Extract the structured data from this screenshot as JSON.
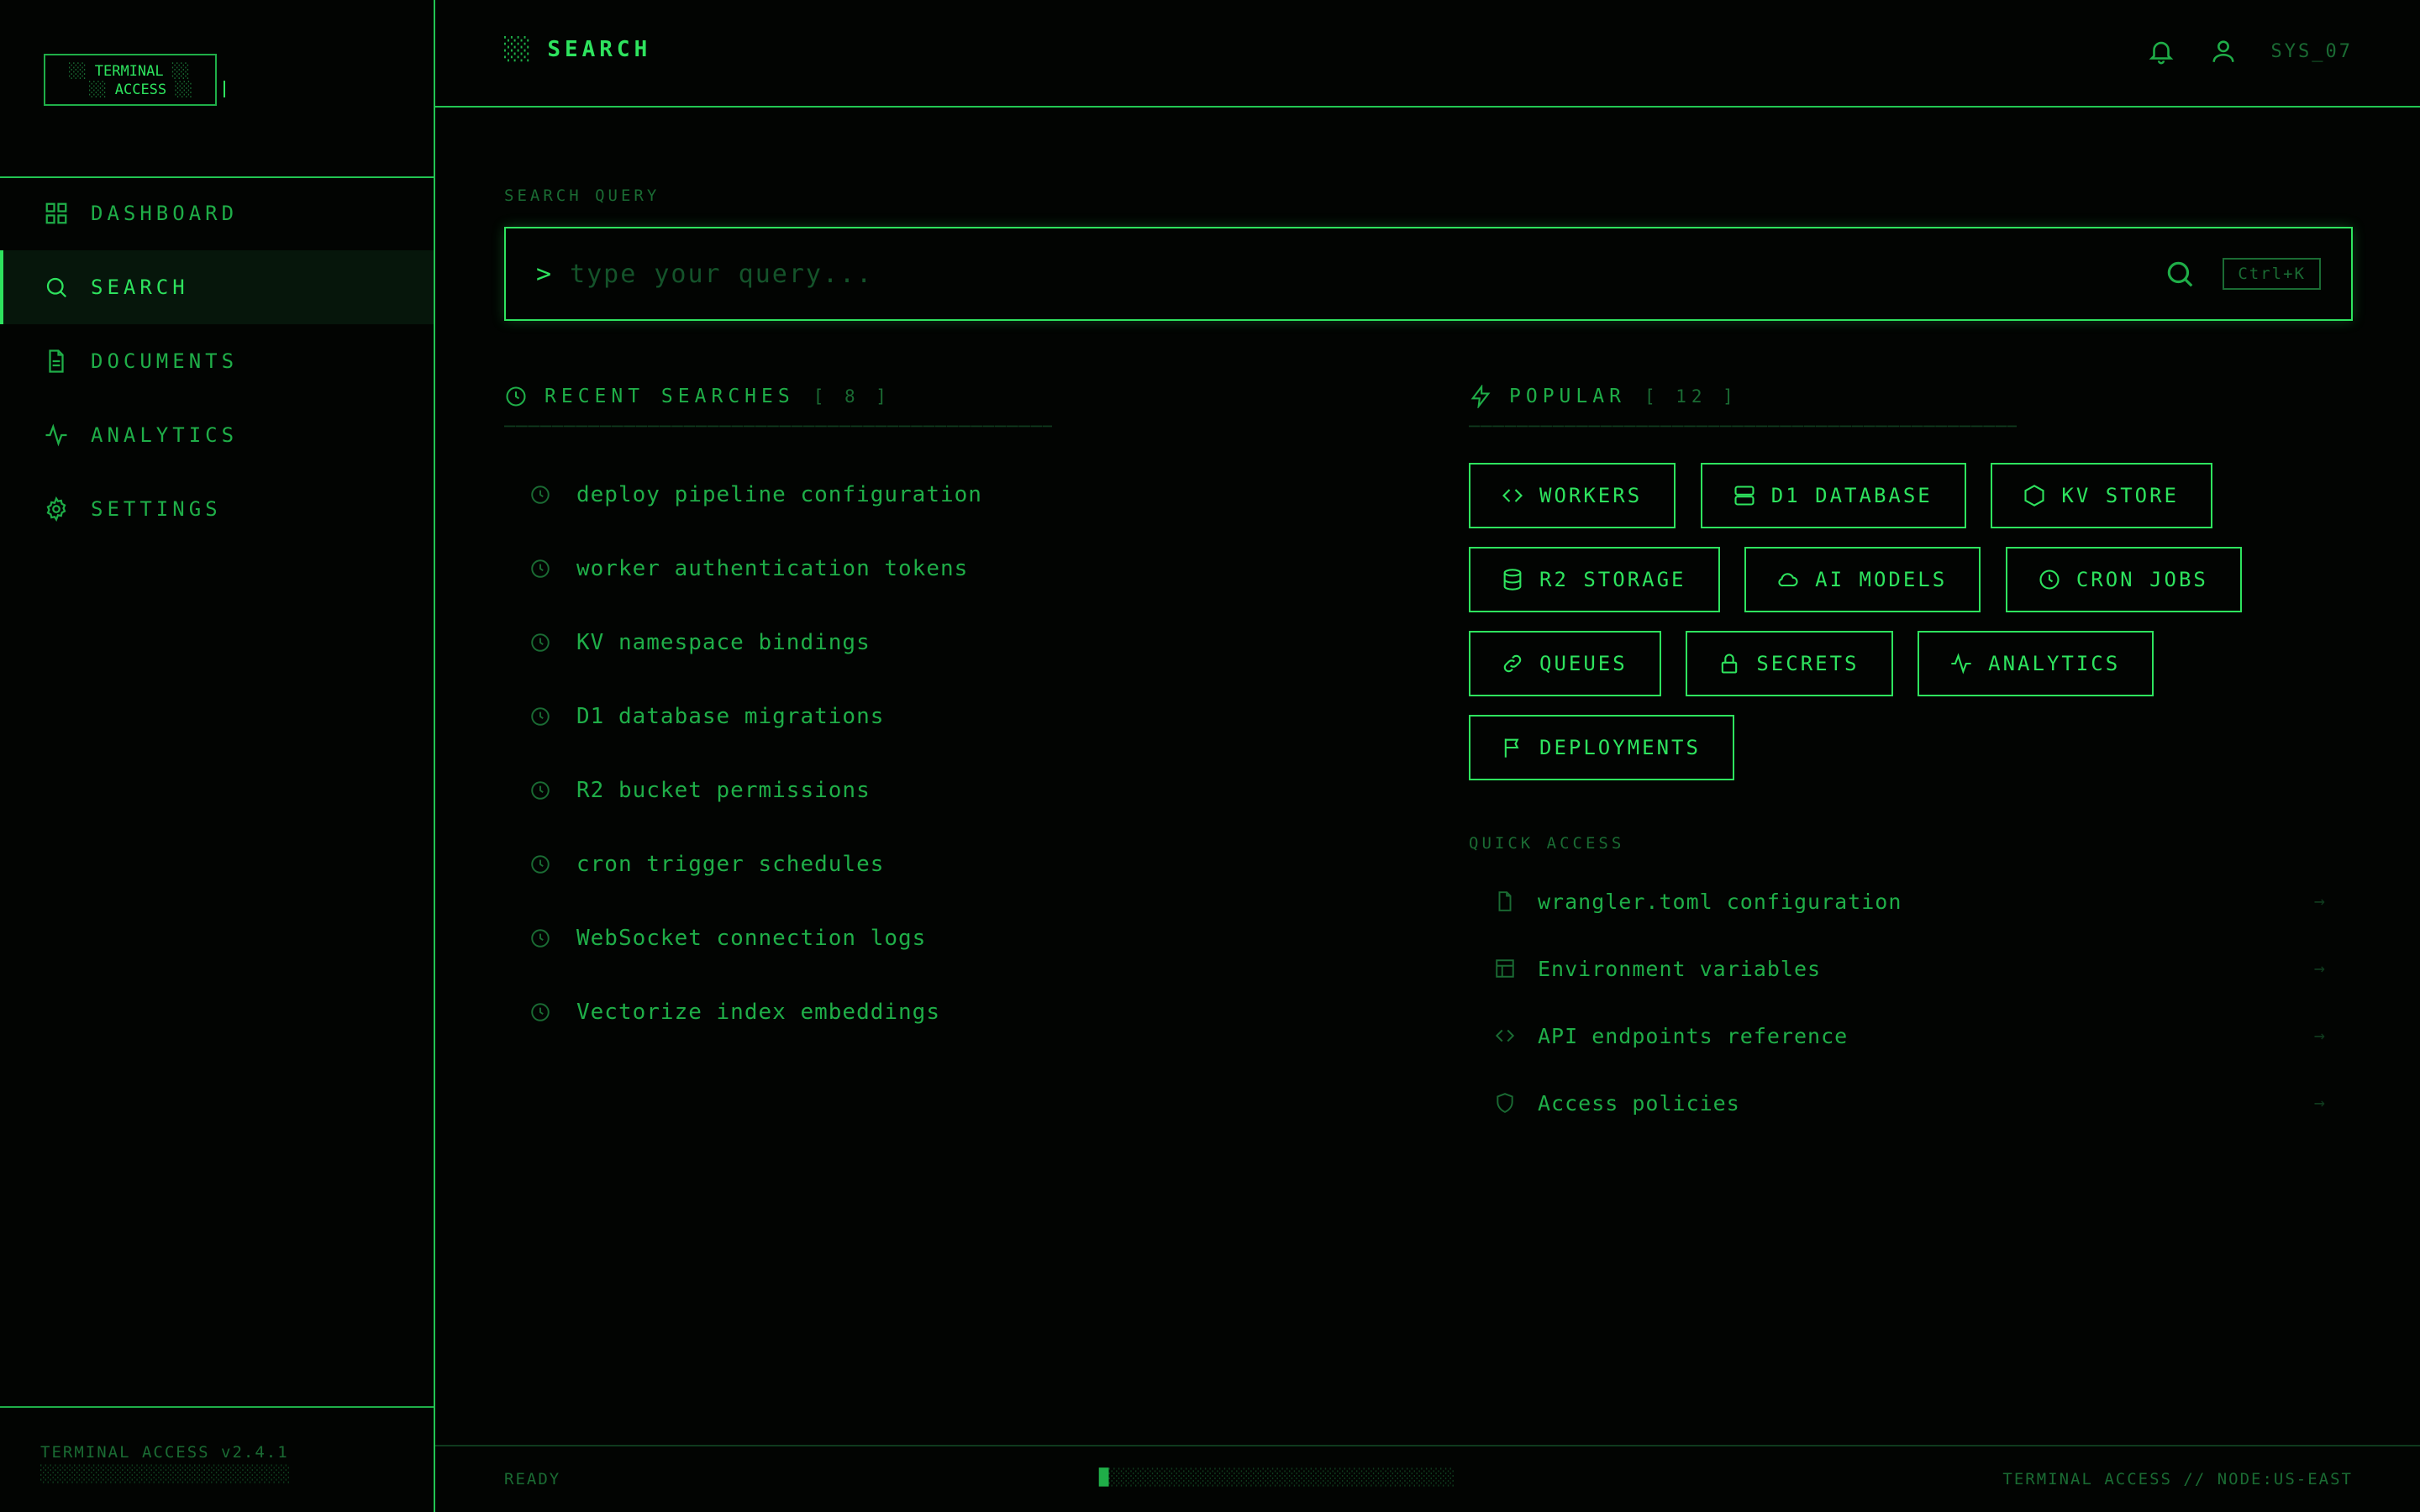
{
  "brand": {
    "line1": "TERMINAL",
    "line2": "ACCESS"
  },
  "nav": [
    {
      "label": "DASHBOARD",
      "icon": "grid-icon",
      "active": false
    },
    {
      "label": "SEARCH",
      "icon": "search-icon",
      "active": true
    },
    {
      "label": "DOCUMENTS",
      "icon": "document-icon",
      "active": false
    },
    {
      "label": "ANALYTICS",
      "icon": "activity-icon",
      "active": false
    },
    {
      "label": "SETTINGS",
      "icon": "gear-icon",
      "active": false
    }
  ],
  "sidebar_footer": {
    "version": "TERMINAL ACCESS v2.4.1"
  },
  "header": {
    "title": "SEARCH",
    "user": "SYS_07"
  },
  "search": {
    "label": "SEARCH QUERY",
    "prompt": ">",
    "placeholder": "type your query...",
    "value": "",
    "shortcut": "Ctrl+K"
  },
  "recent": {
    "title": "RECENT SEARCHES",
    "count": "[ 8 ]",
    "items": [
      "deploy pipeline configuration",
      "worker authentication tokens",
      "KV namespace bindings",
      "D1 database migrations",
      "R2 bucket permissions",
      "cron trigger schedules",
      "WebSocket connection logs",
      "Vectorize index embeddings"
    ]
  },
  "popular": {
    "title": "POPULAR",
    "count": "[ 12 ]",
    "chips": [
      {
        "label": "WORKERS",
        "icon": "code-icon"
      },
      {
        "label": "D1 DATABASE",
        "icon": "server-icon"
      },
      {
        "label": "KV STORE",
        "icon": "hexagon-icon"
      },
      {
        "label": "R2 STORAGE",
        "icon": "database-icon"
      },
      {
        "label": "AI MODELS",
        "icon": "cloud-icon"
      },
      {
        "label": "CRON JOBS",
        "icon": "clock-icon"
      },
      {
        "label": "QUEUES",
        "icon": "link-icon"
      },
      {
        "label": "SECRETS",
        "icon": "lock-icon"
      },
      {
        "label": "ANALYTICS",
        "icon": "activity-icon"
      },
      {
        "label": "DEPLOYMENTS",
        "icon": "flag-icon"
      }
    ]
  },
  "quick_access": {
    "title": "QUICK ACCESS",
    "items": [
      {
        "label": "wrangler.toml configuration",
        "icon": "file-icon",
        "arrow": "→"
      },
      {
        "label": "Environment variables",
        "icon": "layout-icon",
        "arrow": "→"
      },
      {
        "label": "API endpoints reference",
        "icon": "code-icon",
        "arrow": "→"
      },
      {
        "label": "Access policies",
        "icon": "shield-icon",
        "arrow": "→"
      }
    ]
  },
  "status": {
    "left": "READY",
    "right": "TERMINAL ACCESS // NODE:US-EAST",
    "progress": 0.04
  },
  "colors": {
    "accent": "#2ee35e",
    "background": "#020402"
  }
}
